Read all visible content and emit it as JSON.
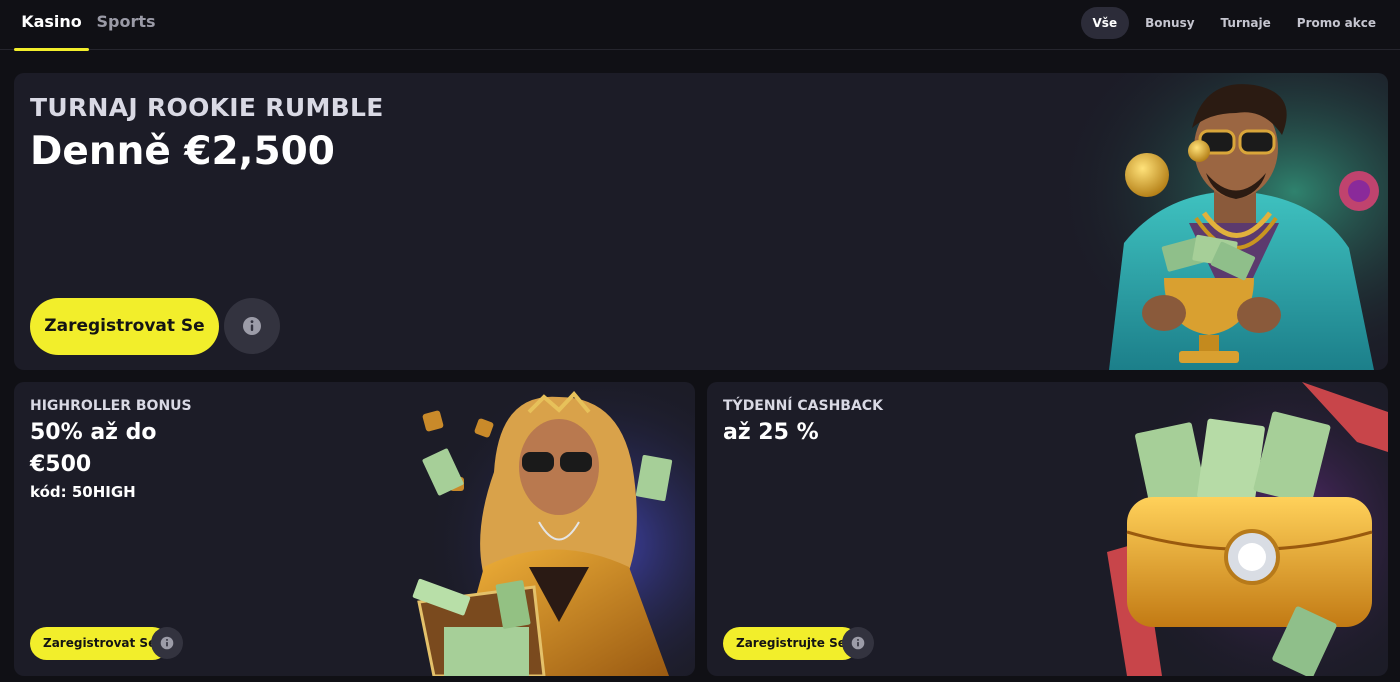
{
  "nav": {
    "tabs": [
      {
        "label": "Kasino",
        "active": true
      },
      {
        "label": "Sports",
        "active": false
      }
    ],
    "filters": [
      {
        "label": "Vše",
        "active": true
      },
      {
        "label": "Bonusy",
        "active": false
      },
      {
        "label": "Turnaje",
        "active": false
      },
      {
        "label": "Promo akce",
        "active": false
      }
    ]
  },
  "hero": {
    "eyebrow": "TURNAJ ROOKIE RUMBLE",
    "headline": "Denně €2,500",
    "cta": "Zaregistrovat Se",
    "info_icon": "info-icon",
    "illustration": "man-with-golden-trophy"
  },
  "highroller": {
    "eyebrow": "HIGHROLLER BONUS",
    "headline_line1": "50% až do",
    "headline_line2": "€500",
    "code": "kód: 50HIGH",
    "cta": "Zaregistrovat Se",
    "info_icon": "info-icon",
    "illustration": "woman-with-money-suitcase"
  },
  "cashback": {
    "eyebrow": "TÝDENNÍ CASHBACK",
    "headline": "až 25 %",
    "cta": "Zaregistrujte Se",
    "info_icon": "info-icon",
    "illustration": "golden-wallet-with-cash"
  },
  "colors": {
    "background": "#101015",
    "card": "#1c1c27",
    "accent": "#f2ee2b",
    "muted": "#9a9aa6"
  }
}
